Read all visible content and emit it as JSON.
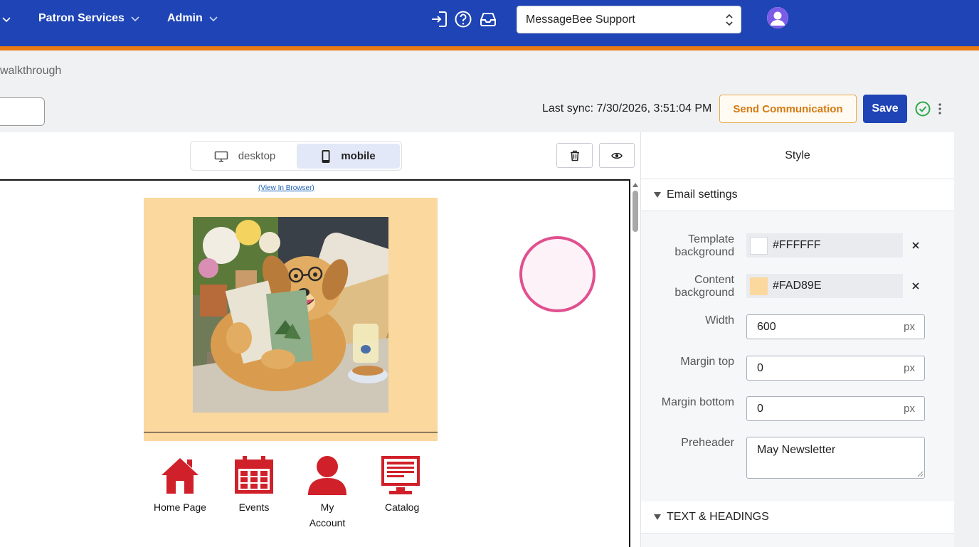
{
  "nav": {
    "menus": [
      "Patron Services",
      "Admin"
    ],
    "icons": [
      "sign-in-icon",
      "help-icon",
      "inbox-icon"
    ],
    "org_select": "MessageBee Support"
  },
  "toolbar": {
    "breadcrumb_tail": "walkthrough",
    "last_sync": "Last sync: 7/30/2026, 3:51:04 PM",
    "send_label": "Send Communication",
    "save_label": "Save"
  },
  "editor": {
    "views": [
      "desktop",
      "mobile"
    ],
    "active_view": "mobile",
    "view_in_browser": "(View In Browser)",
    "nav_tiles": [
      "Home Page",
      "Events",
      "My Account",
      "Catalog"
    ]
  },
  "style_panel": {
    "tab": "Style",
    "email_settings": "Email settings",
    "template_background_label": "Template background",
    "template_background": "#FFFFFF",
    "content_background_label": "Content background",
    "content_background": "#FAD89E",
    "width_label": "Width",
    "width": "600",
    "margin_top_label": "Margin top",
    "margin_top": "0",
    "margin_bottom_label": "Margin bottom",
    "margin_bottom": "0",
    "unit": "px",
    "preheader_label": "Preheader",
    "preheader": "May Newsletter",
    "text_headings": "TEXT & HEADINGS"
  },
  "colors": {
    "brand_blue": "#1f44b5",
    "accent_orange": "#e87b12",
    "icon_red": "#d0202a",
    "cursor_pink": "#e0508f"
  }
}
